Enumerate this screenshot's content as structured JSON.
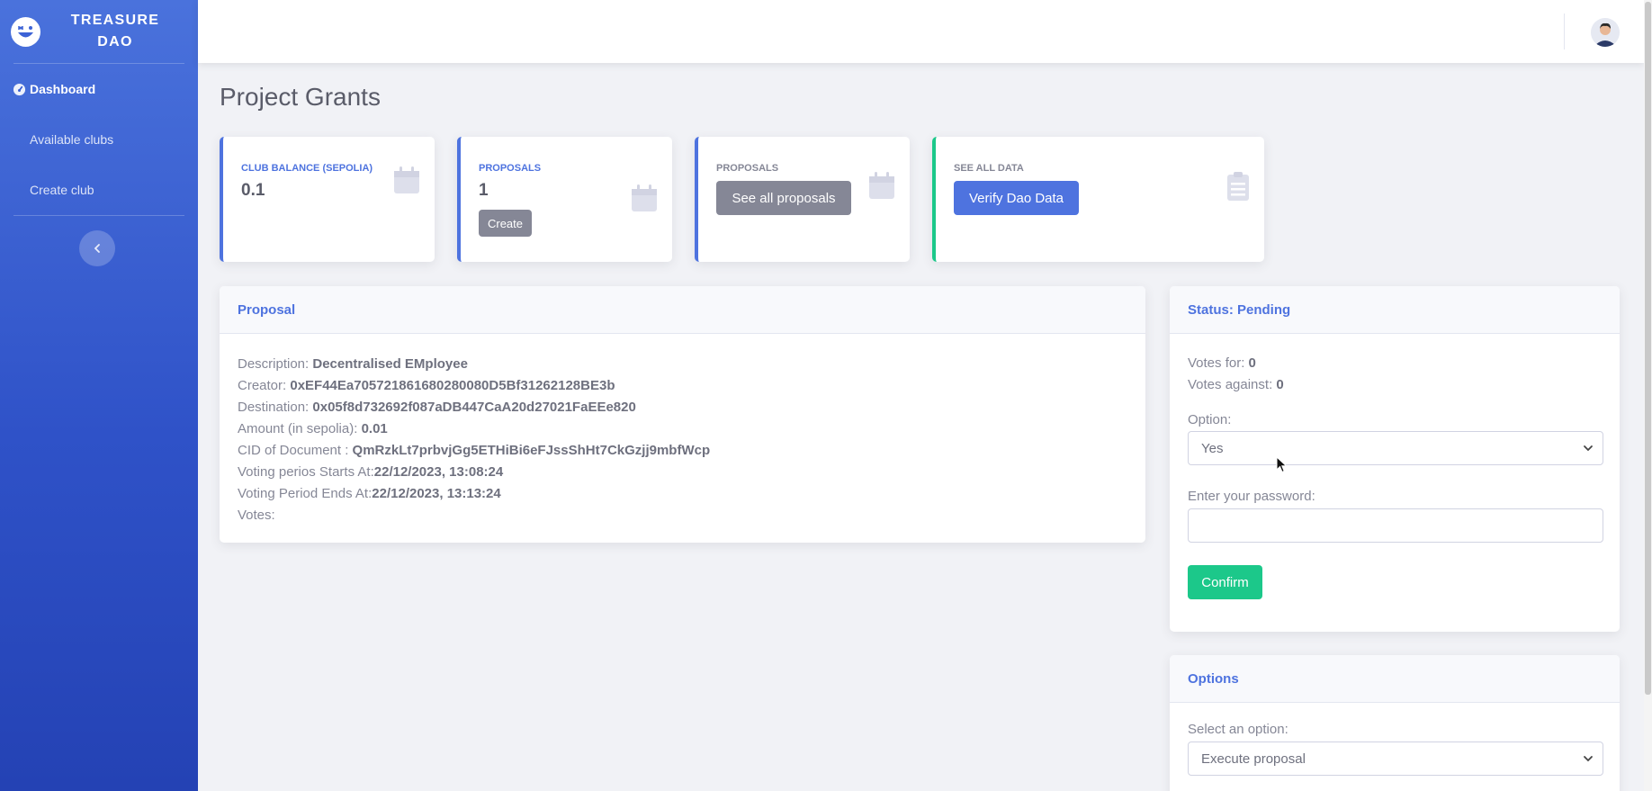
{
  "brand": {
    "name": "TREASURE DAO"
  },
  "sidebar": {
    "items": [
      {
        "label": "Dashboard"
      },
      {
        "label": "Available clubs"
      },
      {
        "label": "Create club"
      }
    ]
  },
  "page": {
    "title": "Project Grants"
  },
  "cards": {
    "balance": {
      "label": "CLUB BALANCE (SEPOLIA)",
      "value": "0.1"
    },
    "proposals": {
      "label": "PROPOSALS",
      "value": "1",
      "button": "Create"
    },
    "all_proposals": {
      "label": "PROPOSALS",
      "button": "See all proposals"
    },
    "all_data": {
      "label": "SEE ALL DATA",
      "button": "Verify Dao Data"
    }
  },
  "proposal": {
    "header": "Proposal",
    "fields": [
      {
        "label": "Description: ",
        "value": "Decentralised EMployee"
      },
      {
        "label": "Creator: ",
        "value": "0xEF44Ea705721861680280080D5Bf31262128BE3b"
      },
      {
        "label": "Destination: ",
        "value": "0x05f8d732692f087aDB447CaA20d27021FaEEe820"
      },
      {
        "label": "Amount (in sepolia): ",
        "value": "0.01"
      },
      {
        "label": "CID of Document : ",
        "value": "QmRzkLt7prbvjGg5ETHiBi6eFJssShHt7CkGzjj9mbfWcp"
      },
      {
        "label": "Voting perios Starts At:",
        "value": "22/12/2023, 13:08:24"
      },
      {
        "label": "Voting Period Ends At:",
        "value": "22/12/2023, 13:13:24"
      },
      {
        "label": "Votes:",
        "value": ""
      }
    ]
  },
  "status": {
    "header": "Status: Pending",
    "votes_for_label": "Votes for: ",
    "votes_for": "0",
    "votes_against_label": "Votes against: ",
    "votes_against": "0",
    "option_label": "Option:",
    "option_value": "Yes",
    "password_label": "Enter your password:",
    "password_value": "",
    "confirm": "Confirm"
  },
  "options": {
    "header": "Options",
    "select_label": "Select an option:",
    "select_value": "Execute proposal"
  },
  "colors": {
    "primary": "#4e73df",
    "success": "#1cc88a",
    "secondary": "#858796",
    "sidebar": "#3b5fd3"
  }
}
